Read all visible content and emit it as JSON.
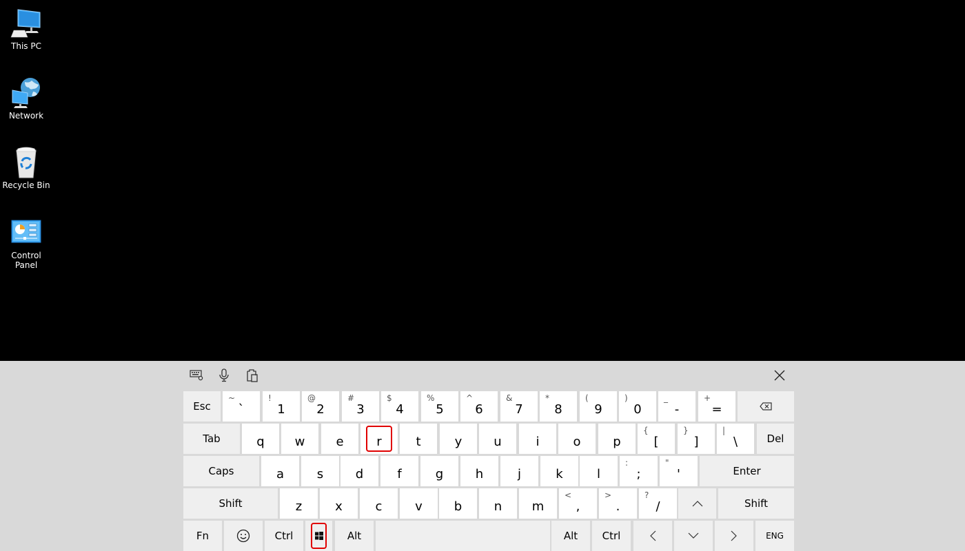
{
  "desktop": {
    "icons": [
      {
        "name": "this-pc",
        "label": "This PC",
        "icon": "computer-icon"
      },
      {
        "name": "network",
        "label": "Network",
        "icon": "network-globe-icon"
      },
      {
        "name": "recycle-bin",
        "label": "Recycle Bin",
        "icon": "recycle-bin-icon"
      },
      {
        "name": "control-panel",
        "label": "Control Panel",
        "icon": "control-panel-icon"
      }
    ]
  },
  "keyboard": {
    "toolbar": {
      "settings": "keyboard-settings-icon",
      "dictation": "microphone-icon",
      "clipboard": "clipboard-icon",
      "close": "close-icon"
    },
    "highlight_color": "#e00000",
    "highlighted_keys": [
      "r",
      "win"
    ],
    "rows": [
      [
        {
          "id": "esc",
          "label": "Esc"
        },
        {
          "id": "backtick",
          "label": "`",
          "shift": "~"
        },
        {
          "id": "1",
          "label": "1",
          "shift": "!"
        },
        {
          "id": "2",
          "label": "2",
          "shift": "@"
        },
        {
          "id": "3",
          "label": "3",
          "shift": "#"
        },
        {
          "id": "4",
          "label": "4",
          "shift": "$"
        },
        {
          "id": "5",
          "label": "5",
          "shift": "%"
        },
        {
          "id": "6",
          "label": "6",
          "shift": "^"
        },
        {
          "id": "7",
          "label": "7",
          "shift": "&"
        },
        {
          "id": "8",
          "label": "8",
          "shift": "*"
        },
        {
          "id": "9",
          "label": "9",
          "shift": "("
        },
        {
          "id": "0",
          "label": "0",
          "shift": ")"
        },
        {
          "id": "minus",
          "label": "-",
          "shift": "_"
        },
        {
          "id": "equals",
          "label": "=",
          "shift": "+"
        },
        {
          "id": "backspace",
          "label": "",
          "icon": "backspace-icon"
        }
      ],
      [
        {
          "id": "tab",
          "label": "Tab"
        },
        {
          "id": "q",
          "label": "q"
        },
        {
          "id": "w",
          "label": "w"
        },
        {
          "id": "e",
          "label": "e"
        },
        {
          "id": "r",
          "label": "r"
        },
        {
          "id": "t",
          "label": "t"
        },
        {
          "id": "y",
          "label": "y"
        },
        {
          "id": "u",
          "label": "u"
        },
        {
          "id": "i",
          "label": "i"
        },
        {
          "id": "o",
          "label": "o"
        },
        {
          "id": "p",
          "label": "p"
        },
        {
          "id": "lbracket",
          "label": "[",
          "shift": "{"
        },
        {
          "id": "rbracket",
          "label": "]",
          "shift": "}"
        },
        {
          "id": "backslash",
          "label": "\\",
          "shift": "|"
        },
        {
          "id": "del",
          "label": "Del"
        }
      ],
      [
        {
          "id": "caps",
          "label": "Caps"
        },
        {
          "id": "a",
          "label": "a"
        },
        {
          "id": "s",
          "label": "s"
        },
        {
          "id": "d",
          "label": "d"
        },
        {
          "id": "f",
          "label": "f"
        },
        {
          "id": "g",
          "label": "g"
        },
        {
          "id": "h",
          "label": "h"
        },
        {
          "id": "j",
          "label": "j"
        },
        {
          "id": "k",
          "label": "k"
        },
        {
          "id": "l",
          "label": "l"
        },
        {
          "id": "semicolon",
          "label": ";",
          "shift": ":"
        },
        {
          "id": "quote",
          "label": "'",
          "shift": "\""
        },
        {
          "id": "enter",
          "label": "Enter"
        }
      ],
      [
        {
          "id": "lshift",
          "label": "Shift"
        },
        {
          "id": "z",
          "label": "z"
        },
        {
          "id": "x",
          "label": "x"
        },
        {
          "id": "c",
          "label": "c"
        },
        {
          "id": "v",
          "label": "v"
        },
        {
          "id": "b",
          "label": "b"
        },
        {
          "id": "n",
          "label": "n"
        },
        {
          "id": "m",
          "label": "m"
        },
        {
          "id": "comma",
          "label": ",",
          "shift": "<"
        },
        {
          "id": "period",
          "label": ".",
          "shift": ">"
        },
        {
          "id": "slash",
          "label": "/",
          "shift": "?"
        },
        {
          "id": "up",
          "label": "",
          "icon": "arrow-up-icon"
        },
        {
          "id": "rshift",
          "label": "Shift"
        }
      ],
      [
        {
          "id": "fn",
          "label": "Fn"
        },
        {
          "id": "emoji",
          "label": "",
          "icon": "emoji-icon"
        },
        {
          "id": "lctrl",
          "label": "Ctrl"
        },
        {
          "id": "win",
          "label": "",
          "icon": "windows-logo-icon"
        },
        {
          "id": "lalt",
          "label": "Alt"
        },
        {
          "id": "space",
          "label": ""
        },
        {
          "id": "ralt",
          "label": "Alt"
        },
        {
          "id": "rctrl",
          "label": "Ctrl"
        },
        {
          "id": "left",
          "label": "",
          "icon": "arrow-left-icon"
        },
        {
          "id": "down",
          "label": "",
          "icon": "arrow-down-icon"
        },
        {
          "id": "right",
          "label": "",
          "icon": "arrow-right-icon"
        },
        {
          "id": "lang",
          "label": "ENG"
        }
      ]
    ]
  }
}
